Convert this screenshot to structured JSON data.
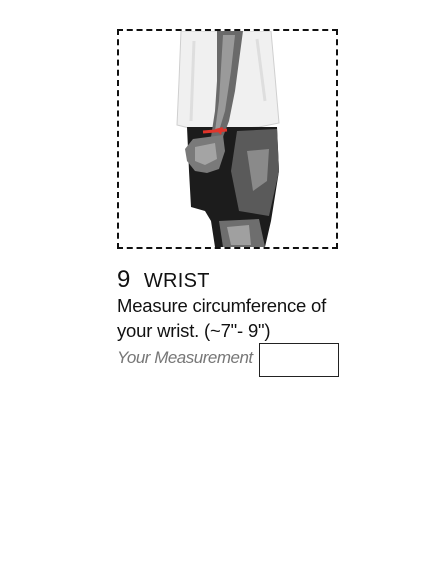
{
  "step": {
    "number": "9",
    "title": "WRIST"
  },
  "instructions": {
    "line1": "Measure circumference of",
    "line2": "your wrist. (~7\"- 9\")"
  },
  "measurement": {
    "label": "Your Measurement",
    "value": ""
  },
  "colors": {
    "accent_tape": "#e0352b",
    "skin": "#7f7f7f",
    "shirt": "#f2f2f2",
    "pants": "#1e1e1e"
  }
}
